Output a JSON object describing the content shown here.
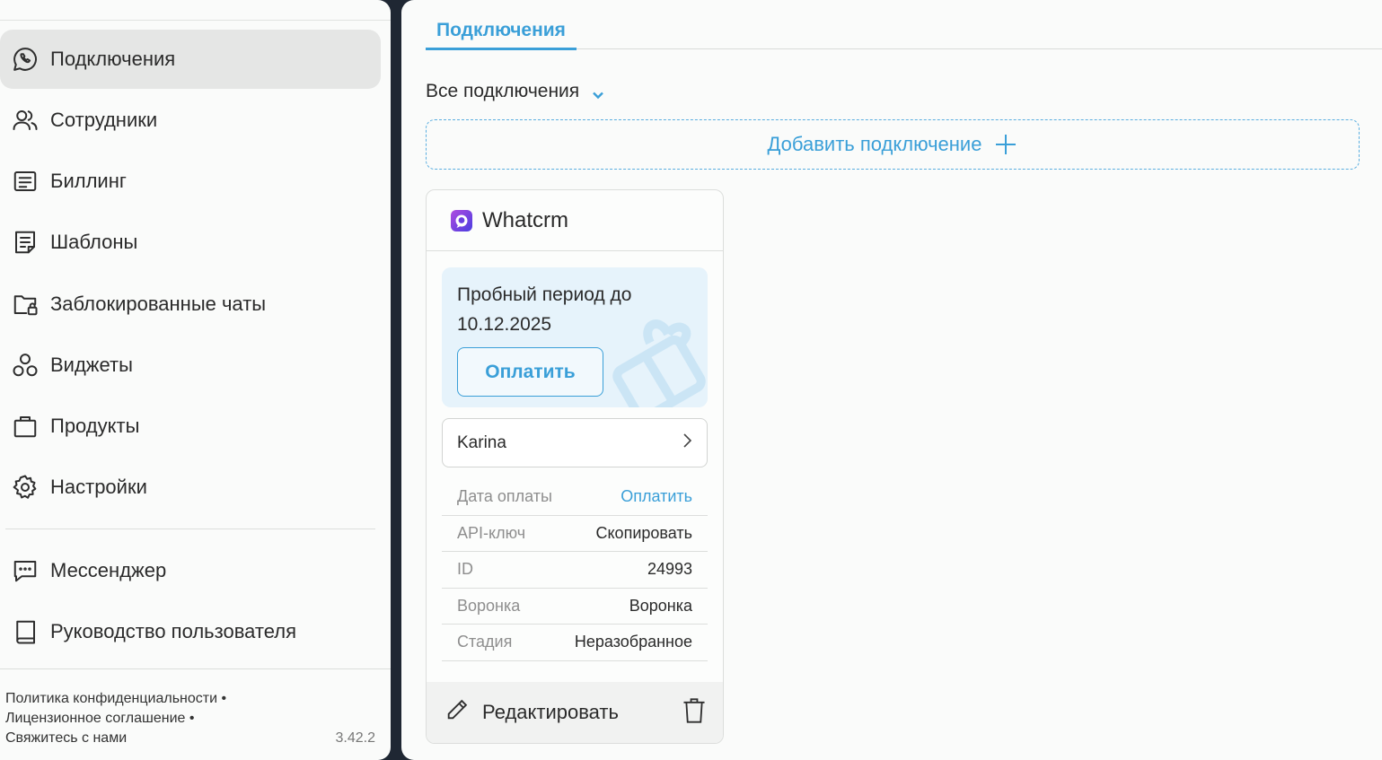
{
  "sidebar": {
    "items": [
      {
        "label": "Подключения",
        "icon": "whatsapp-icon",
        "active": true
      },
      {
        "label": "Сотрудники",
        "icon": "users-icon"
      },
      {
        "label": "Биллинг",
        "icon": "billing-icon"
      },
      {
        "label": "Шаблоны",
        "icon": "templates-icon"
      },
      {
        "label": "Заблокированные чаты",
        "icon": "blocked-folder-icon"
      },
      {
        "label": "Виджеты",
        "icon": "widgets-icon"
      },
      {
        "label": "Продукты",
        "icon": "bag-icon"
      },
      {
        "label": "Настройки",
        "icon": "gear-icon"
      }
    ],
    "secondary": [
      {
        "label": "Мессенджер",
        "icon": "chat-icon"
      },
      {
        "label": "Руководство пользователя",
        "icon": "book-icon"
      }
    ],
    "footer": {
      "privacy": "Политика конфиденциальности",
      "license": "Лицензионное соглашение",
      "contact": "Свяжитесь с нами",
      "separator": "•",
      "version": "3.42.2"
    }
  },
  "main": {
    "tab": "Подключения",
    "filter": "Все подключения",
    "add_button": "Добавить подключение",
    "card": {
      "title": "Whatcrm",
      "trial_text": "Пробный период до 10.12.2025",
      "pay_button": "Оплатить",
      "user": "Karina",
      "rows": [
        {
          "key": "Дата оплаты",
          "value": "Оплатить",
          "link": true
        },
        {
          "key": "API-ключ",
          "value": "Скопировать"
        },
        {
          "key": "ID",
          "value": "24993"
        },
        {
          "key": "Воронка",
          "value": "Воронка"
        },
        {
          "key": "Стадия",
          "value": "Неразобранное"
        }
      ],
      "edit_label": "Редактировать"
    }
  },
  "colors": {
    "accent": "#3a9fd8",
    "sidebar_bg": "#fafbfa",
    "frame_bg": "#1f2733",
    "trial_bg": "#e6f3fb"
  }
}
